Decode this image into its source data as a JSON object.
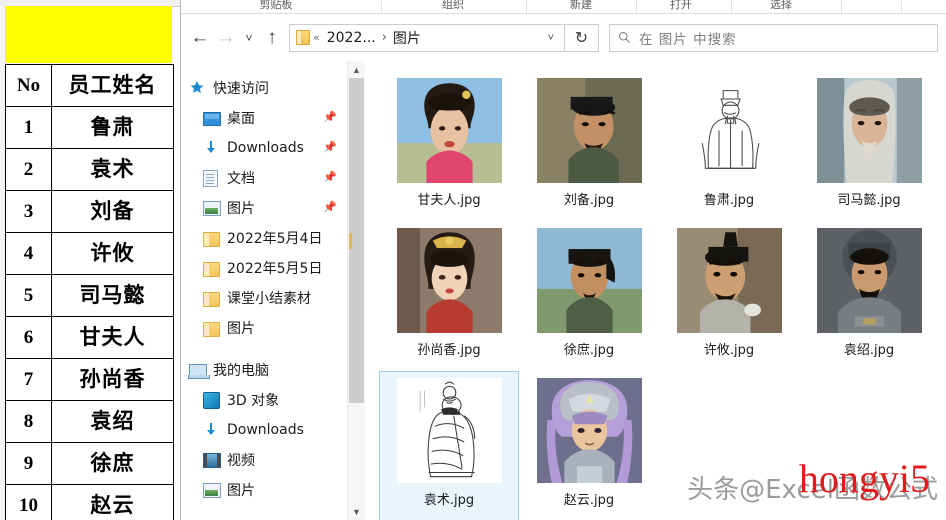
{
  "spreadsheet": {
    "banner_color": "#ffff00",
    "columns": [
      "No",
      "员工姓名"
    ],
    "rows": [
      {
        "no": "1",
        "name": "鲁肃"
      },
      {
        "no": "2",
        "name": "袁术"
      },
      {
        "no": "3",
        "name": "刘备"
      },
      {
        "no": "4",
        "name": "许攸"
      },
      {
        "no": "5",
        "name": "司马懿"
      },
      {
        "no": "6",
        "name": "甘夫人"
      },
      {
        "no": "7",
        "name": "孙尚香"
      },
      {
        "no": "8",
        "name": "袁绍"
      },
      {
        "no": "9",
        "name": "徐庶"
      },
      {
        "no": "10",
        "name": "赵云"
      }
    ]
  },
  "explorer": {
    "ribbon_groups": [
      {
        "label": "剪贴板"
      },
      {
        "label": "组织"
      },
      {
        "label": "新建"
      },
      {
        "label": "打开"
      },
      {
        "label": "选择"
      }
    ],
    "nav": {
      "back_icon": "arrow-left-icon",
      "forward_icon": "arrow-right-icon",
      "recent_icon": "chevron-down-icon",
      "up_icon": "arrow-up-icon",
      "refresh_icon": "refresh-icon"
    },
    "address": {
      "folder_icon": "folder-icon",
      "overflow": "«",
      "crumb1": "2022...",
      "separator": "›",
      "crumb2": "图片",
      "dropdown_icon": "chevron-down-icon"
    },
    "search": {
      "icon": "search-icon",
      "placeholder": "在 图片 中搜索",
      "value": ""
    },
    "sidebar": {
      "groups": [
        {
          "header": {
            "label": "快速访问",
            "icon": "star-pin-icon"
          },
          "items": [
            {
              "label": "桌面",
              "icon": "desktop-icon",
              "pinned": true
            },
            {
              "label": "Downloads",
              "icon": "download-icon",
              "pinned": true
            },
            {
              "label": "文档",
              "icon": "documents-icon",
              "pinned": true
            },
            {
              "label": "图片",
              "icon": "pictures-icon",
              "pinned": true
            },
            {
              "label": "2022年5月4日",
              "icon": "folder-icon",
              "pinned": false
            },
            {
              "label": "2022年5月5日",
              "icon": "folder-icon",
              "pinned": false
            },
            {
              "label": "课堂小结素材",
              "icon": "folder-icon",
              "pinned": false
            },
            {
              "label": "图片",
              "icon": "folder-icon",
              "pinned": false
            }
          ]
        },
        {
          "header": {
            "label": "我的电脑",
            "icon": "this-pc-icon"
          },
          "items": [
            {
              "label": "3D 对象",
              "icon": "3d-objects-icon",
              "pinned": false
            },
            {
              "label": "Downloads",
              "icon": "download-icon",
              "pinned": false
            },
            {
              "label": "视频",
              "icon": "videos-icon",
              "pinned": false
            },
            {
              "label": "图片",
              "icon": "pictures-icon",
              "pinned": false
            }
          ]
        }
      ],
      "scrollbar": {
        "up_icon": "chevron-up-icon",
        "down_icon": "chevron-down-icon"
      }
    },
    "files": [
      {
        "name": "甘夫人.jpg",
        "art": "gan-furen",
        "selected": false
      },
      {
        "name": "刘备.jpg",
        "art": "liubei",
        "selected": false
      },
      {
        "name": "鲁肃.jpg",
        "art": "lusu",
        "selected": false
      },
      {
        "name": "司马懿.jpg",
        "art": "simayi",
        "selected": false
      },
      {
        "name": "孙尚香.jpg",
        "art": "sunshangxiang",
        "selected": false
      },
      {
        "name": "徐庶.jpg",
        "art": "xushu",
        "selected": false
      },
      {
        "name": "许攸.jpg",
        "art": "xuyou",
        "selected": false
      },
      {
        "name": "袁绍.jpg",
        "art": "yuanshao",
        "selected": false
      },
      {
        "name": "袁术.jpg",
        "art": "yuanshu",
        "selected": true
      },
      {
        "name": "赵云.jpg",
        "art": "zhaoyun",
        "selected": false
      }
    ],
    "watermarks": {
      "gray": "头条@Excel函数公式",
      "red": "hongyi5",
      "red_color": "#e01b1b"
    }
  }
}
